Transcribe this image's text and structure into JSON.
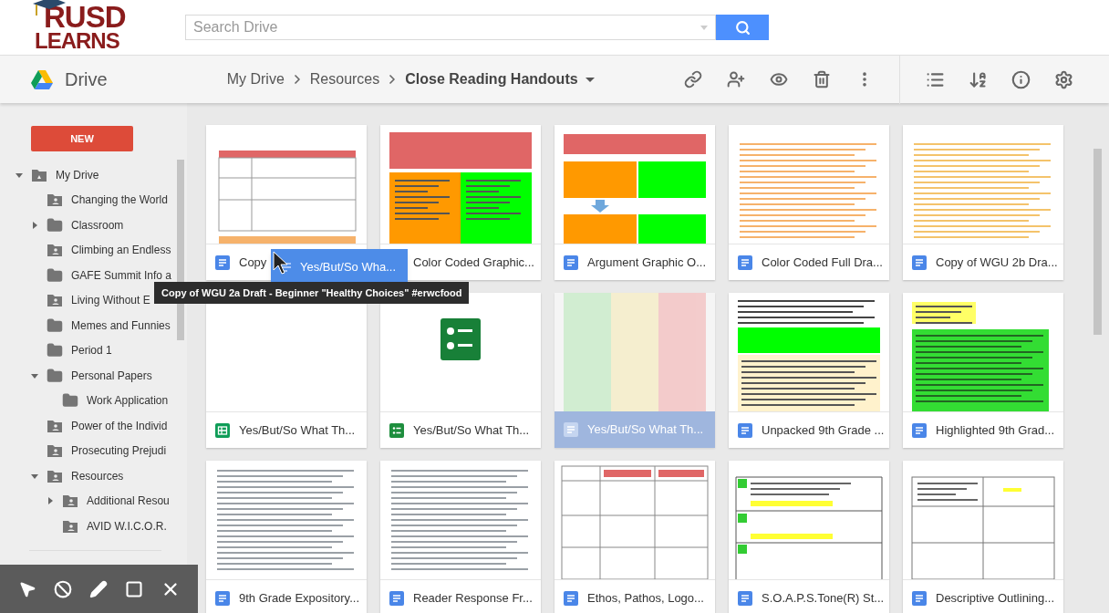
{
  "logo": {
    "line1": "RUSD",
    "line2": "LEARNS"
  },
  "search": {
    "placeholder": "Search Drive"
  },
  "app": {
    "name": "Drive"
  },
  "breadcrumb": [
    {
      "label": "My Drive",
      "current": false
    },
    {
      "label": "Resources",
      "current": false
    },
    {
      "label": "Close Reading Handouts",
      "current": true
    }
  ],
  "new_button": "NEW",
  "sidebar": {
    "items": [
      {
        "label": "My Drive",
        "kind": "drive",
        "expanded": true,
        "children": [
          {
            "label": "Changing the World",
            "kind": "shared"
          },
          {
            "label": "Classroom",
            "kind": "folder",
            "expanded": false
          },
          {
            "label": "Climbing an Endless",
            "kind": "shared"
          },
          {
            "label": "GAFE Summit Info a",
            "kind": "folder"
          },
          {
            "label": "Living Without E",
            "kind": "shared"
          },
          {
            "label": "Memes and Funnies",
            "kind": "folder"
          },
          {
            "label": "Period 1",
            "kind": "folder"
          },
          {
            "label": "Personal Papers",
            "kind": "folder",
            "expanded": true,
            "children": [
              {
                "label": "Work Application",
                "kind": "folder"
              }
            ]
          },
          {
            "label": "Power of the Individ",
            "kind": "shared"
          },
          {
            "label": "Prosecuting Prejudi",
            "kind": "shared"
          },
          {
            "label": "Resources",
            "kind": "shared",
            "expanded": true,
            "children": [
              {
                "label": "Additional Resou",
                "kind": "shared",
                "expanded": false
              },
              {
                "label": "AVID W.I.C.O.R.",
                "kind": "shared"
              }
            ]
          }
        ]
      }
    ]
  },
  "files": [
    {
      "name": "Copy",
      "kind": "doc",
      "dragging": false
    },
    {
      "name": "Color Coded Graphic...",
      "dragging": false
    },
    {
      "name": "Argument Graphic O...",
      "kind": "doc",
      "dragging": false
    },
    {
      "name": "Color Coded Full Dra...",
      "kind": "doc",
      "dragging": false
    },
    {
      "name": "Copy of WGU 2b Dra...",
      "kind": "doc",
      "dragging": false
    },
    {
      "name": "Yes/But/So What Th...",
      "kind": "sheet",
      "dragging": false
    },
    {
      "name": "Yes/But/So What Th...",
      "kind": "form",
      "dragging": false
    },
    {
      "name": "Yes/But/So What Th...",
      "kind": "doc",
      "dragging": true
    },
    {
      "name": "Unpacked 9th Grade ...",
      "kind": "doc",
      "dragging": false
    },
    {
      "name": "Highlighted 9th Grad...",
      "kind": "doc",
      "dragging": false
    },
    {
      "name": "9th Grade Expository...",
      "kind": "doc",
      "dragging": false
    },
    {
      "name": "Reader Response Fr...",
      "kind": "doc",
      "dragging": false
    },
    {
      "name": "Ethos, Pathos, Logo...",
      "kind": "doc",
      "dragging": false
    },
    {
      "name": "S.O.A.P.S.Tone(R) St...",
      "kind": "doc",
      "dragging": false
    },
    {
      "name": "Descriptive Outlining...",
      "kind": "doc",
      "dragging": false
    }
  ],
  "drag_chip": {
    "label": "Yes/But/So Wha..."
  },
  "tooltip": "Copy of WGU 2a Draft - Beginner \"Healthy Choices\" #erwcfood"
}
